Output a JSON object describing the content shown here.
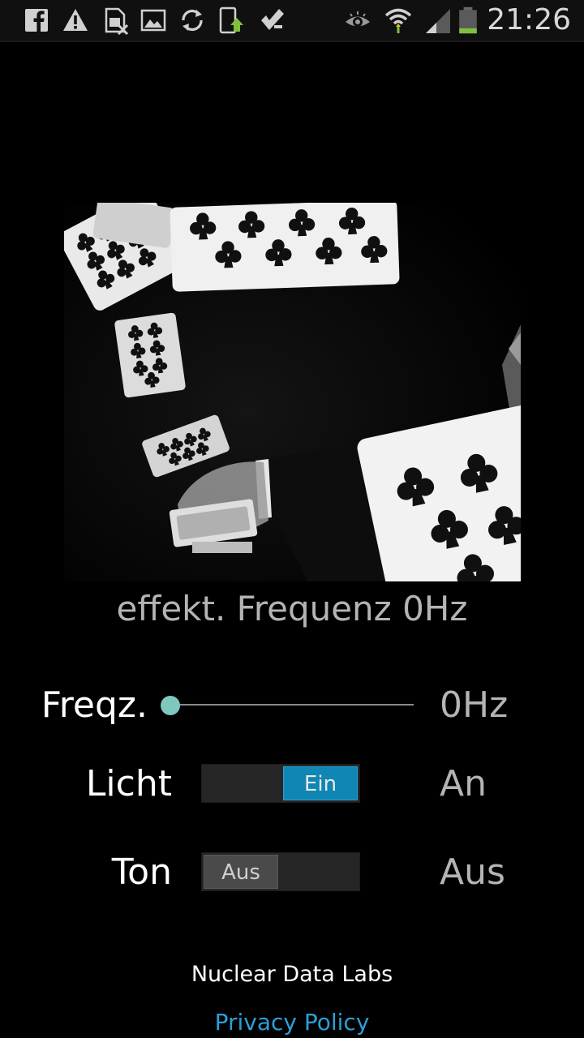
{
  "status_bar": {
    "time": "21:26",
    "icons": [
      "facebook-icon",
      "warning-icon",
      "sim-missing-icon",
      "gallery-icon",
      "sync-icon",
      "device-update-icon",
      "task-check-icon",
      "eye-icon",
      "wifi-icon",
      "signal-icon",
      "battery-icon"
    ],
    "battery_level": 0.45
  },
  "main": {
    "effective_frequency": "effekt. Frequenz 0Hz",
    "frequency": {
      "label": "Freqz.",
      "value_text": "0Hz",
      "slider_level": 0
    },
    "light": {
      "label": "Licht",
      "toggle_text": "Ein",
      "state_text": "An"
    },
    "sound": {
      "label": "Ton",
      "toggle_text": "Aus",
      "state_text": "Aus"
    }
  },
  "footer": {
    "company": "Nuclear Data Labs",
    "privacy_link": "Privacy Policy"
  },
  "colors": {
    "accent": "#0f86b3",
    "link": "#2a9fd6",
    "slider_thumb": "#7ec8c0",
    "background": "#000000"
  }
}
